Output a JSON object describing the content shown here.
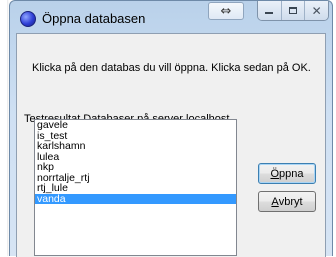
{
  "window": {
    "title": "Öppna databasen",
    "icon": "database-app-icon",
    "controls": {
      "arrows": "⇔",
      "close": "✕"
    }
  },
  "dialog": {
    "instruction": "Klicka på den databas du vill öppna. Klicka sedan på OK.",
    "list_label": "Testresultat Databaser på server localhost",
    "databases": [
      "gavele",
      "is_test",
      "karlshamn",
      "lulea",
      "nkp",
      "norrtalje_rtj",
      "rtj_lule",
      "vanda"
    ],
    "selected": "vanda"
  },
  "buttons": {
    "open_accel": "Ö",
    "open_rest": "ppna",
    "cancel_accel": "A",
    "cancel_rest": "vbryt"
  },
  "colors": {
    "selection": "#3399ff",
    "title_bar": "#b9d1ea"
  }
}
